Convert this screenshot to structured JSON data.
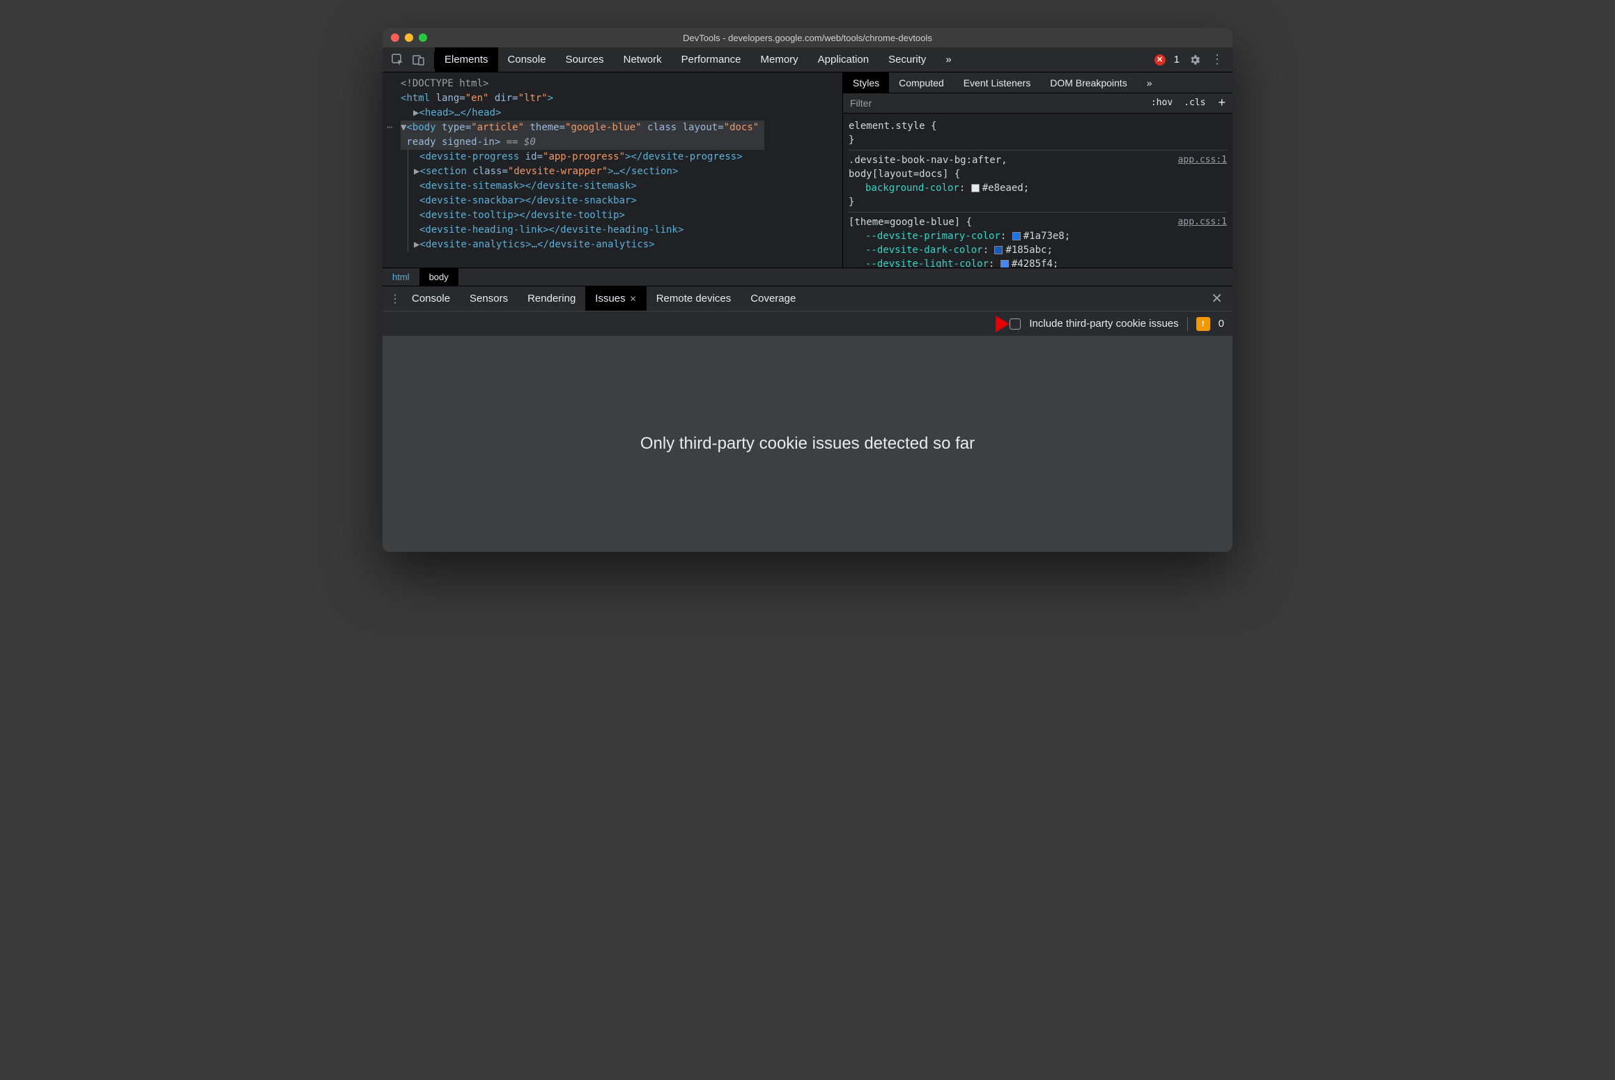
{
  "window_title": "DevTools - developers.google.com/web/tools/chrome-devtools",
  "main_tabs": [
    "Elements",
    "Console",
    "Sources",
    "Network",
    "Performance",
    "Memory",
    "Application",
    "Security"
  ],
  "main_tabs_active": "Elements",
  "error_count": "1",
  "dom": {
    "l0": "<!DOCTYPE html>",
    "l1_open": "<",
    "l1_tag": "html",
    "l1_a1": " lang=",
    "l1_v1": "\"en\"",
    "l1_a2": " dir=",
    "l1_v2": "\"ltr\"",
    "l1_close": ">",
    "l2": "<head>…</head>",
    "l3_open": "<",
    "l3_tag": "body",
    "l3_a1": " type=",
    "l3_v1": "\"article\"",
    "l3_a2": " theme=",
    "l3_v2": "\"google-blue\"",
    "l3_a3": " class layout=",
    "l3_v3": "\"docs\"",
    "l3b": " ready signed-in>",
    "l3eq": " == $0",
    "l4_a": "<",
    "l4_tag": "devsite-progress",
    "l4_attr": " id=",
    "l4_val": "\"app-progress\"",
    "l4_mid": "></",
    "l4_end": ">",
    "l5_a": "<",
    "l5_tag": "section",
    "l5_attr": " class=",
    "l5_val": "\"devsite-wrapper\"",
    "l5_mid": ">…</",
    "l5_end": ">",
    "l6": "<devsite-sitemask></devsite-sitemask>",
    "l7": "<devsite-snackbar></devsite-snackbar>",
    "l8": "<devsite-tooltip></devsite-tooltip>",
    "l9": "<devsite-heading-link></devsite-heading-link>",
    "l10_a": "<",
    "l10_tag": "devsite-analytics",
    "l10_mid": ">…</",
    "l10_end": ">"
  },
  "crumbs": [
    "html",
    "body"
  ],
  "crumbs_active": "body",
  "sub_tabs": [
    "Styles",
    "Computed",
    "Event Listeners",
    "DOM Breakpoints"
  ],
  "sub_tabs_active": "Styles",
  "filter_placeholder": "Filter",
  "hov": ":hov",
  "cls": ".cls",
  "rules": {
    "r1_sel": "element.style ",
    "r2_src": "app.css:1",
    "r2_sel": ".devsite-book-nav-bg:after,\nbody[layout=docs] ",
    "r2_p1": "background-color",
    "r2_v1": "#e8eaed",
    "r2_c1": "#e8eaed",
    "r3_src": "app.css:1",
    "r3_sel": "[theme=google-blue] ",
    "r3_p1": "--devsite-primary-color",
    "r3_v1": "#1a73e8",
    "r3_c1": "#1a73e8",
    "r3_p2": "--devsite-dark-color",
    "r3_v2": "#185abc",
    "r3_c2": "#185abc",
    "r3_p3": "--devsite-light-color",
    "r3_v3": "#4285f4",
    "r3_c3": "#4285f4"
  },
  "drawer_tabs": [
    "Console",
    "Sensors",
    "Rendering",
    "Issues",
    "Remote devices",
    "Coverage"
  ],
  "drawer_tabs_active": "Issues",
  "issues_checkbox_label": "Include third-party cookie issues",
  "issues_warn_count": "0",
  "issues_message": "Only third-party cookie issues detected so far"
}
